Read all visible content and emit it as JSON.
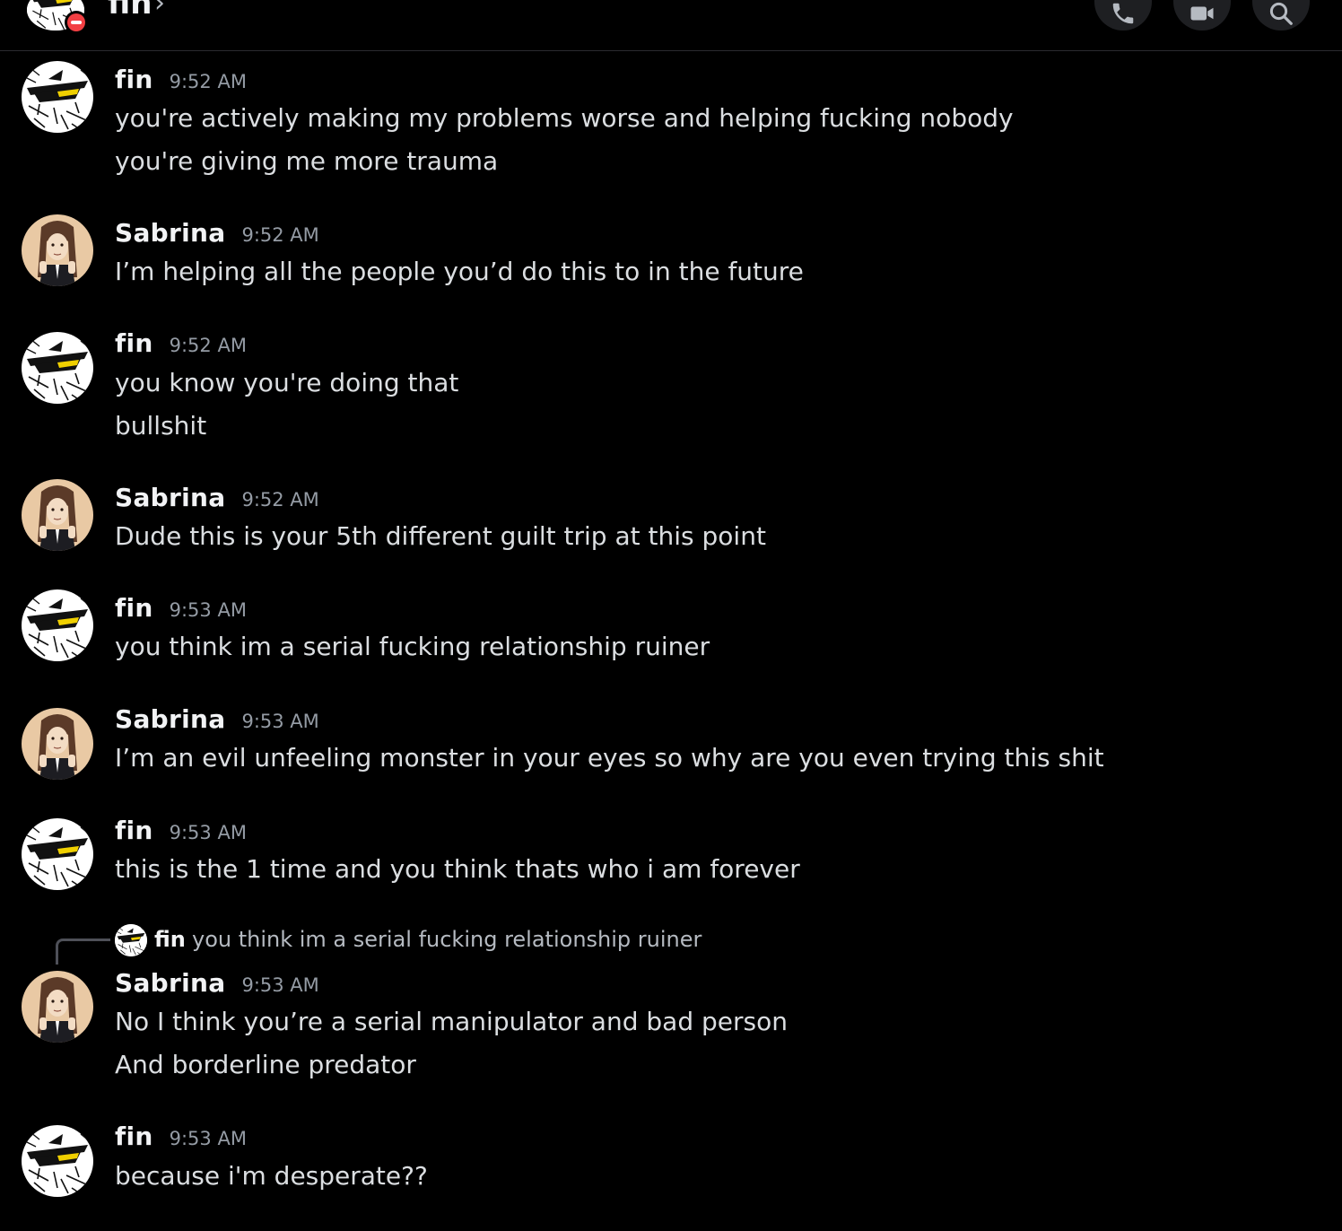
{
  "header": {
    "title": "fin",
    "status": "do-not-disturb",
    "buttons": {
      "call_icon": "phone-icon",
      "video_icon": "video-camera-icon",
      "search_icon": "search-icon"
    }
  },
  "users": {
    "fin": {
      "name": "fin",
      "avatar_icon": "fin-avatar"
    },
    "sabrina": {
      "name": "Sabrina",
      "avatar_icon": "sabrina-avatar"
    }
  },
  "messages": [
    {
      "author": "fin",
      "time": "9:52 AM",
      "lines": [
        "you're actively making my problems worse and helping fucking nobody",
        "you're giving me more trauma"
      ]
    },
    {
      "author": "Sabrina",
      "time": "9:52 AM",
      "lines": [
        "I’m helping all the people you’d do this to in the future"
      ]
    },
    {
      "author": "fin",
      "time": "9:52 AM",
      "lines": [
        "you know you're doing that",
        "bullshit"
      ]
    },
    {
      "author": "Sabrina",
      "time": "9:52 AM",
      "lines": [
        "Dude this is your 5th different guilt trip at this point"
      ]
    },
    {
      "author": "fin",
      "time": "9:53 AM",
      "lines": [
        "you think im a serial fucking relationship ruiner"
      ]
    },
    {
      "author": "Sabrina",
      "time": "9:53 AM",
      "lines": [
        "I’m an evil unfeeling monster in your eyes so why are you even trying this shit"
      ]
    },
    {
      "author": "fin",
      "time": "9:53 AM",
      "lines": [
        "this is the 1 time and you think thats who i am forever"
      ]
    },
    {
      "author": "Sabrina",
      "time": "9:53 AM",
      "reply_to": {
        "author": "fin",
        "text": "you think im a serial fucking relationship ruiner"
      },
      "lines": [
        "No I think you’re a serial manipulator and bad person",
        "And borderline predator"
      ]
    },
    {
      "author": "fin",
      "time": "9:53 AM",
      "lines": [
        "because i'm desperate??"
      ]
    }
  ],
  "colors": {
    "background": "#000000",
    "author": "#f2f3f5",
    "text": "#dbdee1",
    "timestamp": "#949ba4",
    "dnd": "#f23f43"
  }
}
